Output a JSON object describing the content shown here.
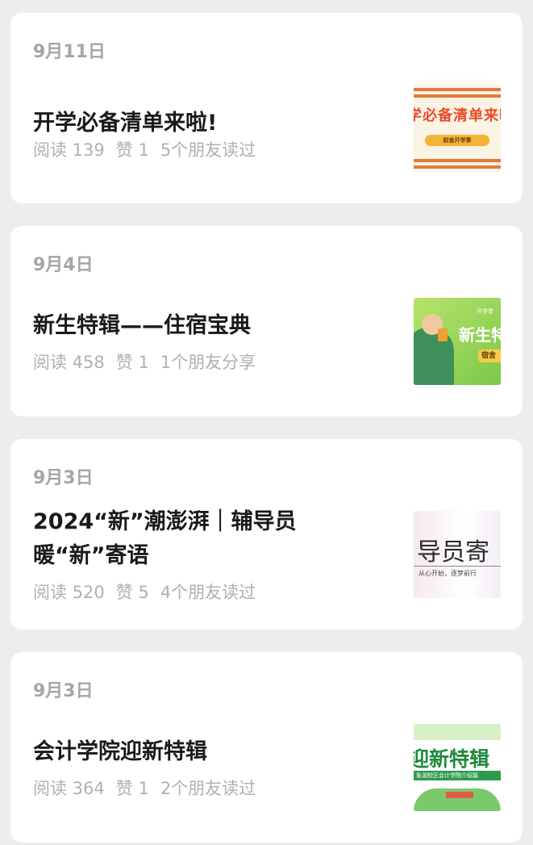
{
  "articles": [
    {
      "date": "9月11日",
      "title": "开学必备清单来啦!",
      "reads": "阅读 139",
      "likes": "赞 1",
      "friends": "5个朋友读过",
      "thumb_text": "学必备清单来啦",
      "thumb_pill": "财金开学季"
    },
    {
      "date": "9月4日",
      "title": "新生特辑——住宿宝典",
      "reads": "阅读 458",
      "likes": "赞 1",
      "friends": "1个朋友分享",
      "thumb_text": "新生特",
      "thumb_tag": "宿舍",
      "thumb_small": "开学季 ·"
    },
    {
      "date": "9月3日",
      "title": "2024“新”潮澎湃｜辅导员暖“新”寄语",
      "reads": "阅读 520",
      "likes": "赞 5",
      "friends": "4个朋友读过",
      "thumb_text": "导员寄",
      "thumb_sub": "从心开始，逐梦前行"
    },
    {
      "date": "9月3日",
      "title": "会计学院迎新特辑",
      "reads": "阅读 364",
      "likes": "赞 1",
      "friends": "2个朋友读过",
      "thumb_text": "迎新特辑",
      "thumb_band": "象湖校区会计学院介绍篇"
    }
  ],
  "colors": {
    "background": "#ededed",
    "card": "#ffffff",
    "meta_text": "#b0b0b0"
  }
}
